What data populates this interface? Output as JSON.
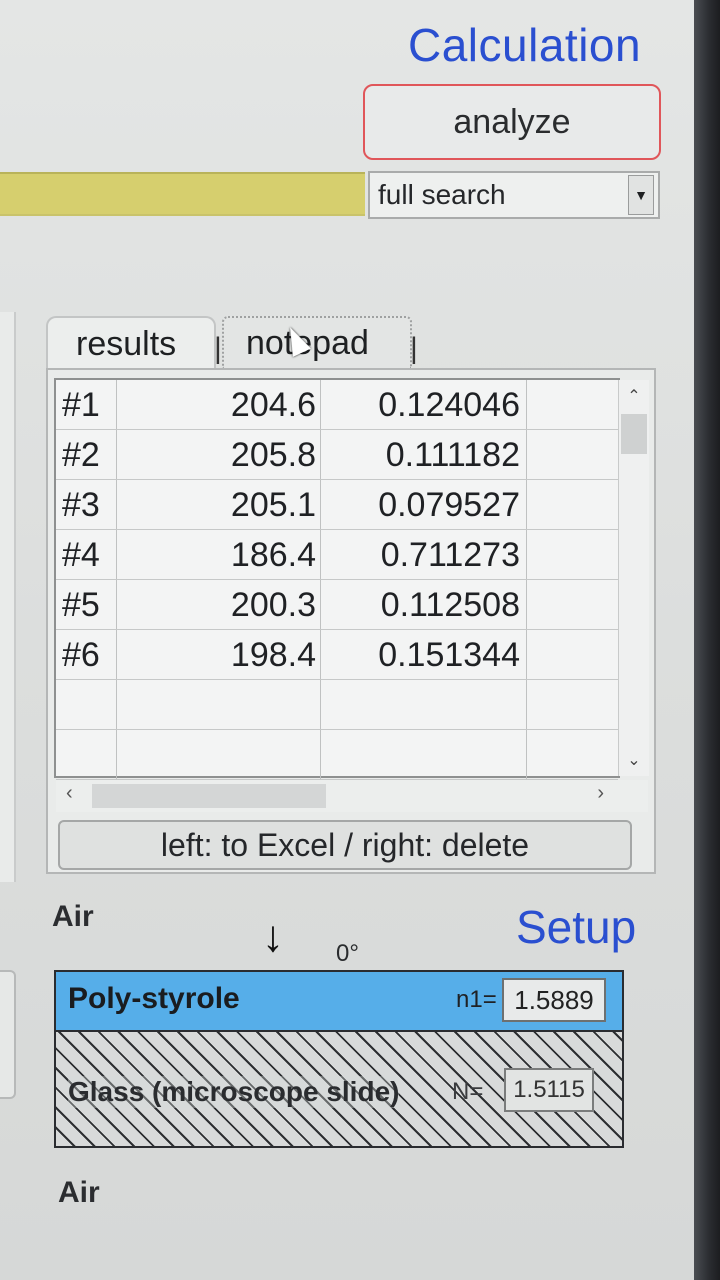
{
  "calculation": {
    "title": "Calculation",
    "analyze_label": "analyze",
    "search_mode": "full search"
  },
  "tabs": [
    {
      "label": "results"
    },
    {
      "label": "notepad"
    }
  ],
  "results": {
    "rows": [
      {
        "id": "#1",
        "a": "204.6",
        "b": "0.124046"
      },
      {
        "id": "#2",
        "a": "205.8",
        "b": "0.111182"
      },
      {
        "id": "#3",
        "a": "205.1",
        "b": "0.079527"
      },
      {
        "id": "#4",
        "a": "186.4",
        "b": "0.711273"
      },
      {
        "id": "#5",
        "a": "200.3",
        "b": "0.112508"
      },
      {
        "id": "#6",
        "a": "198.4",
        "b": "0.151344"
      }
    ],
    "excel_button_label": "left: to Excel / right: delete"
  },
  "setup": {
    "title": "Setup",
    "top_medium": "Air",
    "bottom_medium": "Air",
    "angle": "0°",
    "layers": [
      {
        "name": "Poly-styrole",
        "n_label": "n1=",
        "n_value": "1.5889",
        "color": "#56aee9"
      },
      {
        "name": "Glass (microscope slide)",
        "n_label": "N=",
        "n_value": "1.5115"
      }
    ]
  },
  "icons": {
    "dropdown": "chevron-down-icon",
    "direction": "down-arrow-icon",
    "scroll_up": "chevron-up-icon",
    "scroll_down": "chevron-down-icon",
    "scroll_left": "chevron-left-icon",
    "scroll_right": "chevron-right-icon"
  },
  "colors": {
    "accent_title": "#2a4fd0",
    "analyze_border": "#e0565a",
    "yellow_bar": "#d6cf6e"
  }
}
